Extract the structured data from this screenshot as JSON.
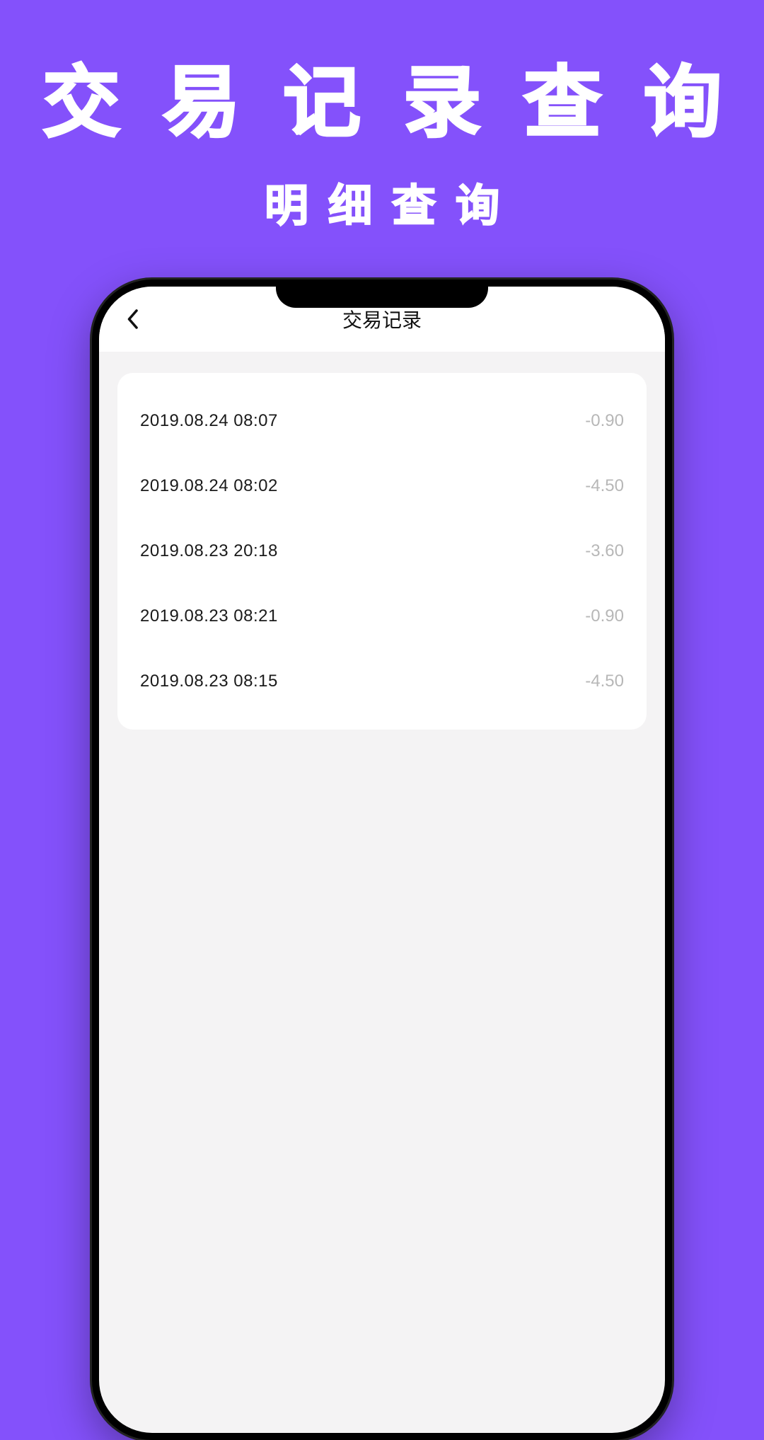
{
  "hero": {
    "title": "交易记录查询",
    "subtitle": "明细查询"
  },
  "app": {
    "header": {
      "title": "交易记录"
    },
    "transactions": [
      {
        "datetime": "2019.08.24 08:07",
        "amount": "-0.90"
      },
      {
        "datetime": "2019.08.24 08:02",
        "amount": "-4.50"
      },
      {
        "datetime": "2019.08.23 20:18",
        "amount": "-3.60"
      },
      {
        "datetime": "2019.08.23 08:21",
        "amount": "-0.90"
      },
      {
        "datetime": "2019.08.23 08:15",
        "amount": "-4.50"
      }
    ]
  }
}
